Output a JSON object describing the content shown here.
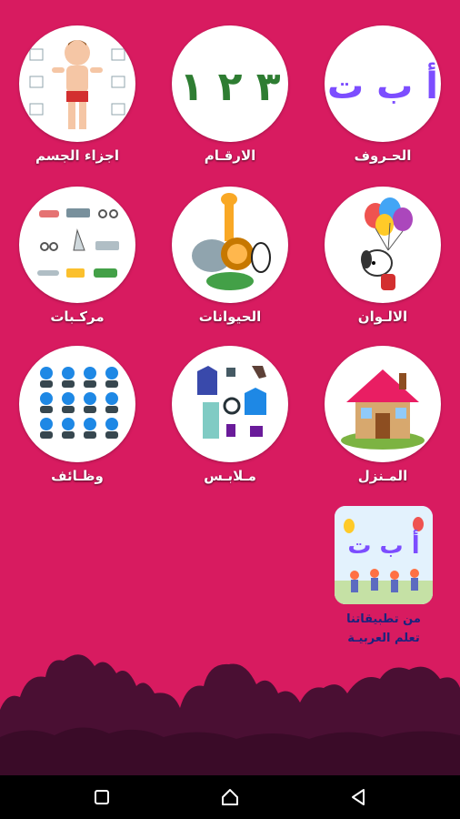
{
  "colors": {
    "background": "#d81b60",
    "tile_circle": "#ffffff",
    "label_text": "#ffffff",
    "promo_text": "#1a237e",
    "bushes": "#4a0f33",
    "navbar": "#000000"
  },
  "categories": [
    {
      "id": "letters",
      "label": "الحـروف",
      "icon": "arabic-letters-icon"
    },
    {
      "id": "numbers",
      "label": "الارقـام",
      "icon": "arabic-numbers-icon"
    },
    {
      "id": "body_parts",
      "label": "اجزاء الجسم",
      "icon": "body-parts-icon"
    },
    {
      "id": "colors",
      "label": "الالـوان",
      "icon": "balloons-dog-icon"
    },
    {
      "id": "animals",
      "label": "الحيوانات",
      "icon": "animals-icon"
    },
    {
      "id": "vehicles",
      "label": "مركـبات",
      "icon": "vehicles-icon"
    },
    {
      "id": "house",
      "label": "المـنزل",
      "icon": "house-icon"
    },
    {
      "id": "clothes",
      "label": "مـلابـس",
      "icon": "clothes-icon"
    },
    {
      "id": "jobs",
      "label": "وظـائف",
      "icon": "professions-icon"
    }
  ],
  "icon_text": {
    "letters": "أ ب ت",
    "numbers": "٣ ٢ ١"
  },
  "promo": {
    "line1": "من تطبيقاتنا",
    "line2": "تعلم العربيـة",
    "image_letters": "أ ب ت"
  },
  "navbar": {
    "back_icon": "back-triangle-icon",
    "home_icon": "home-icon",
    "recents_icon": "recents-square-icon"
  }
}
